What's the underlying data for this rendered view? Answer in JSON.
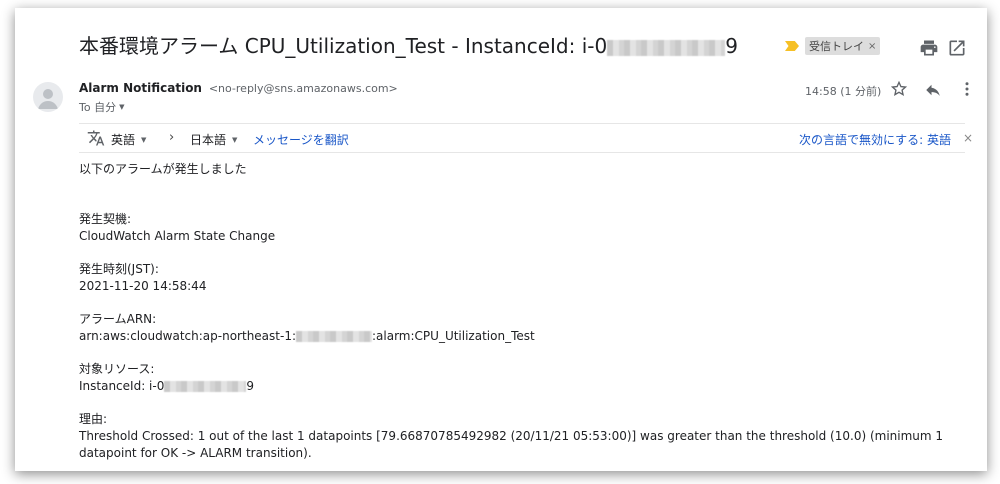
{
  "email": {
    "subject_prefix": "本番環境アラーム CPU_Utilization_Test - InstanceId: i-0",
    "subject_suffix": "9",
    "label": "受信トレイ",
    "label_close": "×",
    "sender_name": "Alarm Notification",
    "sender_email": "<no-reply@sns.amazonaws.com>",
    "to_text": "To 自分",
    "timestamp": "14:58 (1 分前)"
  },
  "translate": {
    "source_lang": "英語",
    "target_lang": "日本語",
    "translate_link": "メッセージを翻訳",
    "never_translate": "次の言語で無効にする: 英語",
    "arrow": "›",
    "close": "×"
  },
  "body": {
    "intro": "以下のアラームが発生しました",
    "trigger_label": "発生契機:",
    "trigger_value": "CloudWatch Alarm State Change",
    "time_label": "発生時刻(JST):",
    "time_value": "2021-11-20 14:58:44",
    "arn_label": "アラームARN:",
    "arn_prefix": "arn:aws:cloudwatch:ap-northeast-1:",
    "arn_suffix": ":alarm:CPU_Utilization_Test",
    "instance_label": "対象リソース:",
    "instance_prefix": "InstanceId: i-0",
    "instance_suffix": "9",
    "reason_label": "理由:",
    "reason_value": "Threshold Crossed: 1 out of the last 1 datapoints [79.66870785492982 (20/11/21 05:53:00)] was greater than the threshold (10.0) (minimum 1 datapoint for OK -> ALARM transition)."
  },
  "colors": {
    "link": "#1a57c8",
    "important_marker": "#f6c026",
    "label_chip": "#dddddd"
  },
  "icons": [
    "print-icon",
    "open-in-new-window-icon",
    "star-icon",
    "reply-icon",
    "more-vert-icon",
    "translate-icon",
    "avatar-icon"
  ]
}
